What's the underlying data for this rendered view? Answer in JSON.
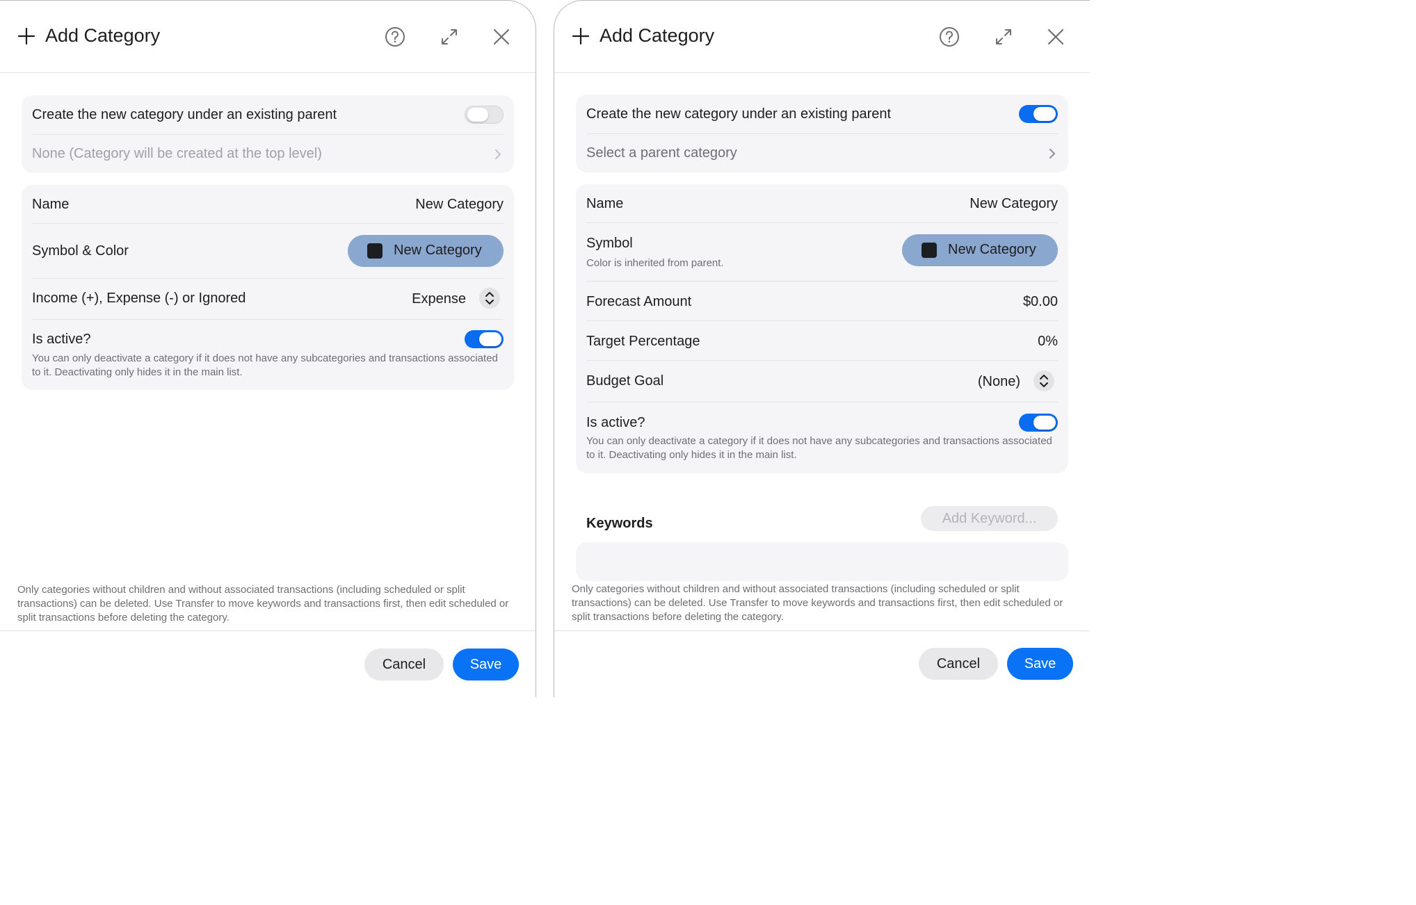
{
  "left": {
    "title": "Add Category",
    "parent_toggle_label": "Create the new category under an existing parent",
    "parent_toggle_on": false,
    "parent_value": "None (Category will be created at the top level)",
    "name_label": "Name",
    "name_value": "New Category",
    "symbol_label": "Symbol & Color",
    "symbol_button": "New Category",
    "type_label": "Income (+), Expense (-) or Ignored",
    "type_value": "Expense",
    "active_label": "Is active?",
    "active_on": true,
    "active_help": "You can only deactivate a category if it does not have any subcategories and transactions associated to it. Deactivating only hides it in the main list.",
    "footnote": "Only categories without children and without associated transactions (including scheduled or split transactions) can be deleted. Use Transfer to move keywords and transactions first, then edit scheduled or split transactions before deleting the category.",
    "cancel": "Cancel",
    "save": "Save"
  },
  "right": {
    "title": "Add Category",
    "parent_toggle_label": "Create the new category under an existing parent",
    "parent_toggle_on": true,
    "parent_value": "Select a parent category",
    "name_label": "Name",
    "name_value": "New Category",
    "symbol_label": "Symbol",
    "symbol_help": "Color is inherited from parent.",
    "symbol_button": "New Category",
    "forecast_label": "Forecast Amount",
    "forecast_value": "$0.00",
    "target_label": "Target Percentage",
    "target_value": "0%",
    "goal_label": "Budget Goal",
    "goal_value": "(None)",
    "active_label": "Is active?",
    "active_on": true,
    "active_help": "You can only deactivate a category if it does not have any subcategories and transactions associated to it. Deactivating only hides it in the main list.",
    "keywords_label": "Keywords",
    "add_keyword": "Add Keyword...",
    "footnote": "Only categories without children and without associated transactions (including scheduled or split transactions) can be deleted. Use Transfer to move keywords and transactions first, then edit scheduled or split transactions before deleting the category.",
    "cancel": "Cancel",
    "save": "Save"
  },
  "icons": [
    "plus-icon",
    "help-icon",
    "expand-icon",
    "close-icon",
    "chevron-right-icon",
    "up-down-chevron-icon"
  ],
  "colors": {
    "accent": "#0a72f5",
    "symbol_pill": "#8aa7cf",
    "group_bg": "#f5f5f7"
  }
}
